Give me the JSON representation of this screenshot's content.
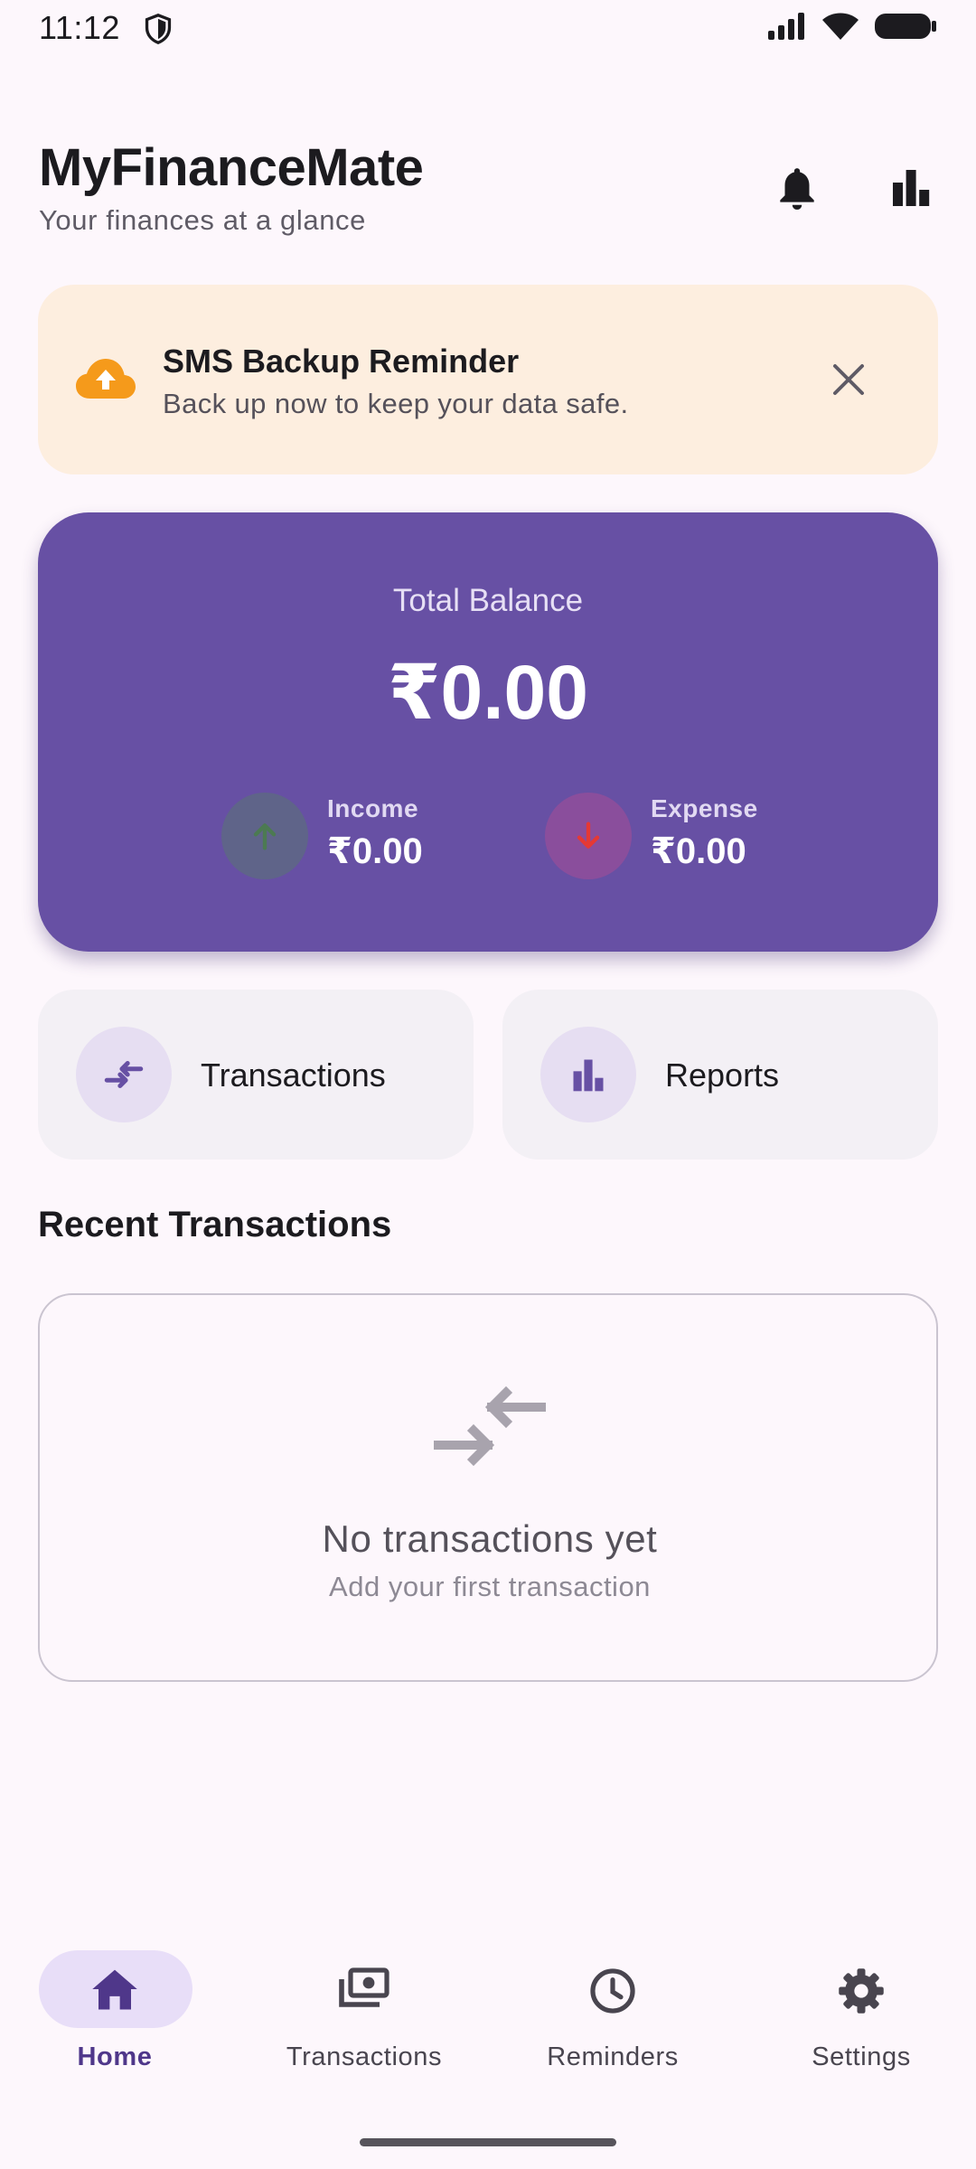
{
  "status_bar": {
    "time": "11:12"
  },
  "header": {
    "title": "MyFinanceMate",
    "subtitle": "Your finances at a glance",
    "icons": [
      "bell-icon",
      "bar-chart-icon"
    ]
  },
  "banner": {
    "title": "SMS Backup Reminder",
    "text": "Back up now to keep your data safe.",
    "icon": "cloud-upload-icon",
    "accent_color": "#f59a1b"
  },
  "balance": {
    "label": "Total Balance",
    "amount": "₹0.00",
    "income_label": "Income",
    "income_value": "₹0.00",
    "expense_label": "Expense",
    "expense_value": "₹0.00",
    "card_color": "#6750a4"
  },
  "quick_actions": [
    {
      "label": "Transactions",
      "icon": "swap-arrows-icon"
    },
    {
      "label": "Reports",
      "icon": "bar-chart-icon"
    }
  ],
  "recent": {
    "title": "Recent Transactions",
    "empty_title": "No transactions yet",
    "empty_subtitle": "Add your first transaction"
  },
  "bottom_nav": {
    "items": [
      {
        "label": "Home",
        "icon": "home-icon",
        "active": true
      },
      {
        "label": "Transactions",
        "icon": "payments-icon",
        "active": false
      },
      {
        "label": "Reminders",
        "icon": "clock-icon",
        "active": false
      },
      {
        "label": "Settings",
        "icon": "gear-icon",
        "active": false
      }
    ],
    "active_color": "#4f378a"
  }
}
